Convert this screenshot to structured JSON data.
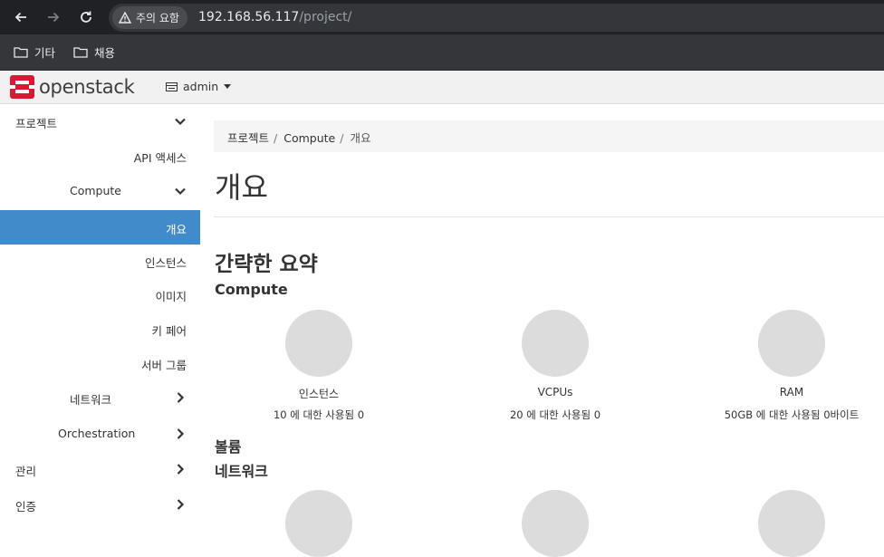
{
  "browser": {
    "security_chip": "주의 요함",
    "url_host": "192.168.56.117",
    "url_path": "/project/",
    "bookmarks": [
      "기타",
      "채용"
    ]
  },
  "header": {
    "brand": "openstack",
    "project_selector": "admin"
  },
  "sidebar": {
    "items": [
      {
        "label": "프로젝트"
      },
      {
        "label": "API 액세스"
      },
      {
        "label": "Compute"
      },
      {
        "label": "개요"
      },
      {
        "label": "인스턴스"
      },
      {
        "label": "이미지"
      },
      {
        "label": "키 페어"
      },
      {
        "label": "서버 그룹"
      },
      {
        "label": "네트워크"
      },
      {
        "label": "Orchestration"
      },
      {
        "label": "관리"
      },
      {
        "label": "인증"
      }
    ]
  },
  "breadcrumb": [
    "프로젝트",
    "Compute",
    "개요"
  ],
  "page_title": "개요",
  "summary_heading": "간략한 요약",
  "compute_heading": "Compute",
  "compute_usage": [
    {
      "title": "인스턴스",
      "text": "10 에 대한 사용됨 0",
      "used_fraction": 0
    },
    {
      "title": "VCPUs",
      "text": "20 에 대한 사용됨 0",
      "used_fraction": 0
    },
    {
      "title": "RAM",
      "text": "50GB 에 대한 사용됨 0바이트",
      "used_fraction": 0
    }
  ],
  "volume_heading": "볼륨",
  "network_heading": "네트워크",
  "colors": {
    "active_nav": "#428bca",
    "pie_empty": "#dcdcdc",
    "brand_red": "#da1a32"
  }
}
